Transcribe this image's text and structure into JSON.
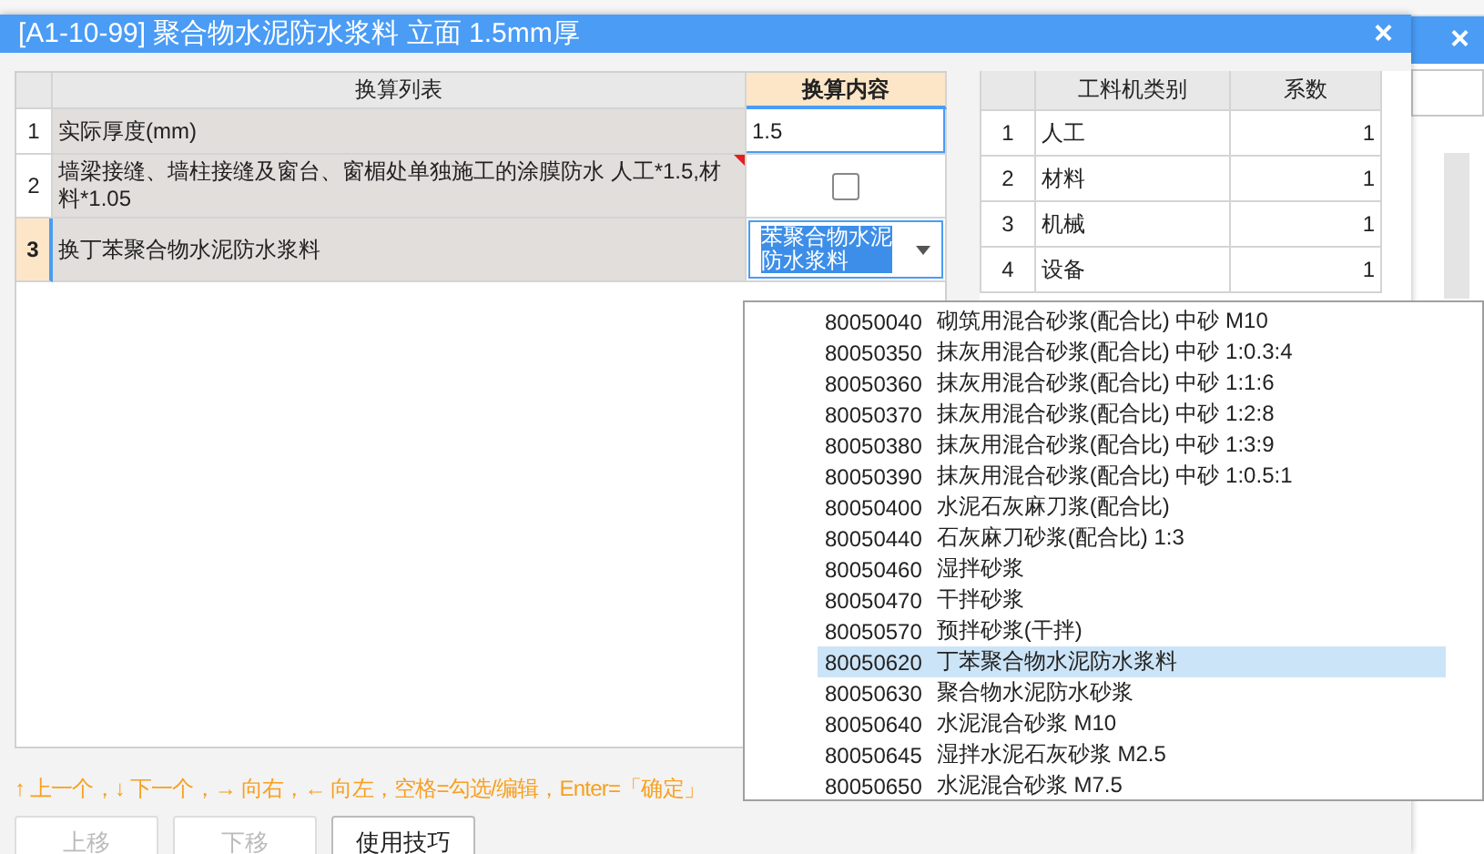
{
  "dialog": {
    "title": "[A1-10-99] 聚合物水泥防水浆料 立面 1.5mm厚",
    "close": "×"
  },
  "conversion_table": {
    "columns": [
      "换算列表",
      "换算内容"
    ],
    "rows": [
      {
        "number": "1",
        "item": "实际厚度(mm)",
        "kind": "text",
        "value": "1.5",
        "flagged": false,
        "selected": false
      },
      {
        "number": "2",
        "item": "墙梁接缝、墙柱接缝及窗台、窗楣处单独施工的涂膜防水 人工*1.5,材料*1.05",
        "kind": "checkbox",
        "checked": false,
        "flagged": true,
        "selected": false
      },
      {
        "number": "3",
        "item": "换丁苯聚合物水泥防水浆料",
        "kind": "dropdown",
        "value": "苯聚合物水泥防水浆料",
        "flagged": false,
        "selected": true
      }
    ]
  },
  "resource_table": {
    "columns": [
      "工料机类别",
      "系数"
    ],
    "rows": [
      {
        "number": "1",
        "category": "人工",
        "coefficient": "1"
      },
      {
        "number": "2",
        "category": "材料",
        "coefficient": "1"
      },
      {
        "number": "3",
        "category": "机械",
        "coefficient": "1"
      },
      {
        "number": "4",
        "category": "设备",
        "coefficient": "1"
      }
    ]
  },
  "dropdown_list": {
    "items": [
      {
        "code": "80050040",
        "name": "砌筑用混合砂浆(配合比) 中砂 M10",
        "selected": false
      },
      {
        "code": "80050350",
        "name": "抹灰用混合砂浆(配合比) 中砂 1:0.3:4",
        "selected": false
      },
      {
        "code": "80050360",
        "name": "抹灰用混合砂浆(配合比) 中砂 1:1:6",
        "selected": false
      },
      {
        "code": "80050370",
        "name": "抹灰用混合砂浆(配合比) 中砂 1:2:8",
        "selected": false
      },
      {
        "code": "80050380",
        "name": "抹灰用混合砂浆(配合比) 中砂 1:3:9",
        "selected": false
      },
      {
        "code": "80050390",
        "name": "抹灰用混合砂浆(配合比) 中砂 1:0.5:1",
        "selected": false
      },
      {
        "code": "80050400",
        "name": "水泥石灰麻刀浆(配合比)",
        "selected": false
      },
      {
        "code": "80050440",
        "name": "石灰麻刀砂浆(配合比) 1:3",
        "selected": false
      },
      {
        "code": "80050460",
        "name": "湿拌砂浆",
        "selected": false
      },
      {
        "code": "80050470",
        "name": "干拌砂浆",
        "selected": false
      },
      {
        "code": "80050570",
        "name": "预拌砂浆(干拌)",
        "selected": false
      },
      {
        "code": "80050620",
        "name": "丁苯聚合物水泥防水浆料",
        "selected": true
      },
      {
        "code": "80050630",
        "name": "聚合物水泥防水砂浆",
        "selected": false
      },
      {
        "code": "80050640",
        "name": "水泥混合砂浆 M10",
        "selected": false
      },
      {
        "code": "80050645",
        "name": "湿拌水泥石灰砂浆 M2.5",
        "selected": false
      },
      {
        "code": "80050650",
        "name": "水泥混合砂浆 M7.5",
        "selected": false
      }
    ]
  },
  "hint": "↑ 上一个，↓ 下一个，→ 向右，← 向左，空格=勾选/编辑，Enter=「确定」",
  "buttons": [
    {
      "label": "上移",
      "disabled": true
    },
    {
      "label": "下移",
      "disabled": true
    },
    {
      "label": "使用技巧",
      "disabled": false
    }
  ],
  "background_window": {
    "close": "×"
  }
}
